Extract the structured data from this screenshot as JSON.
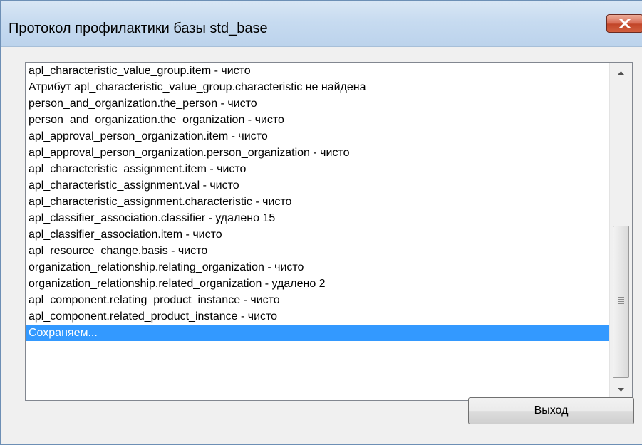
{
  "window": {
    "title": "Протокол профилактики базы std_base"
  },
  "list": {
    "items": [
      "apl_characteristic_value_group.item -  чисто",
      "Атрибут apl_characteristic_value_group.characteristic не найдена",
      "person_and_organization.the_person -  чисто",
      "person_and_organization.the_organization -  чисто",
      "apl_approval_person_organization.item -  чисто",
      "apl_approval_person_organization.person_organization -  чисто",
      "apl_characteristic_assignment.item -  чисто",
      "apl_characteristic_assignment.val -  чисто",
      "apl_characteristic_assignment.characteristic -  чисто",
      "apl_classifier_association.classifier - удалено  15",
      "apl_classifier_association.item -  чисто",
      "apl_resource_change.basis -  чисто",
      "organization_relationship.relating_organization -  чисто",
      "organization_relationship.related_organization - удалено  2",
      "apl_component.relating_product_instance -  чисто",
      "apl_component.related_product_instance -  чисто",
      "Сохраняем..."
    ],
    "selected_index": 16
  },
  "buttons": {
    "exit_label": "Выход"
  },
  "colors": {
    "selection": "#3399ff",
    "close_button": "#c94a2d",
    "titlebar": "#c7dbf0"
  },
  "icons": {
    "close": "close-icon",
    "scroll_up": "scroll-up-arrow-icon",
    "scroll_down": "scroll-down-arrow-icon",
    "grip": "scroll-grip-icon"
  }
}
